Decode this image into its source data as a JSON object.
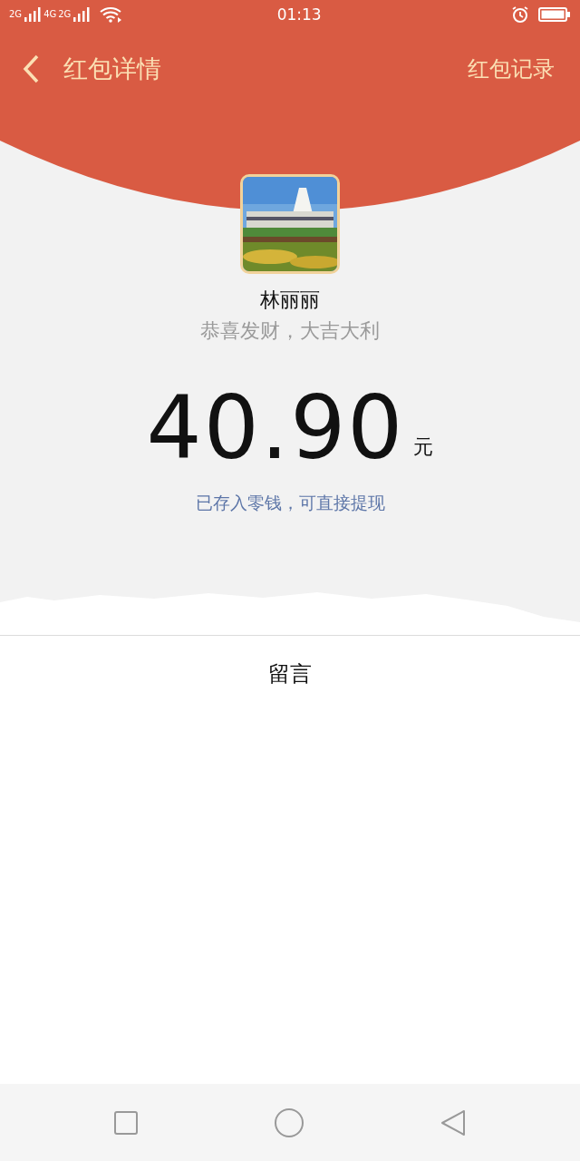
{
  "status_bar": {
    "network_labels": [
      "2G",
      "4G",
      "2G"
    ],
    "time": "01:13"
  },
  "header": {
    "title": "红包详情",
    "action": "红包记录"
  },
  "sender": {
    "name": "林丽丽",
    "greeting": "恭喜发财，大吉大利"
  },
  "amount": {
    "value": "40.90",
    "unit": "元",
    "note": "已存入零钱，可直接提现"
  },
  "message_section": {
    "title": "留言"
  }
}
